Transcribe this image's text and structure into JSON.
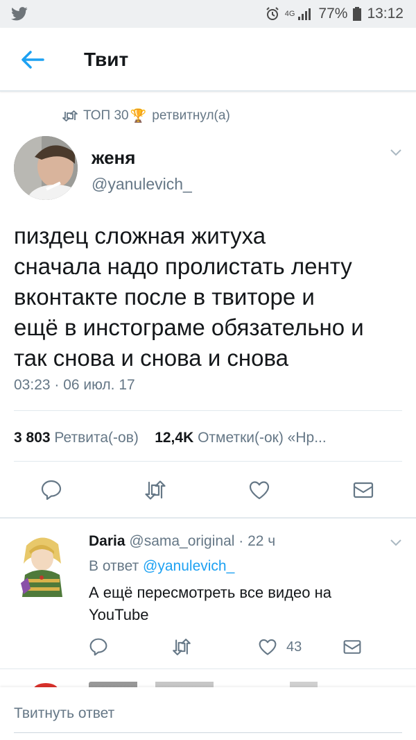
{
  "status_bar": {
    "app_icon": "twitter-bird-icon",
    "network": "4G",
    "battery": "77%",
    "time": "13:12"
  },
  "header": {
    "back_icon": "arrow-left-icon",
    "title": "Твит"
  },
  "retweet_context": {
    "icon": "retweet-icon",
    "user": "ТОП 30",
    "user_emoji": "🏆",
    "text": "ретвитнул(а)"
  },
  "tweet": {
    "author_name": "женя",
    "author_handle": "@yanulevich_",
    "text": "пиздец сложная житуха\nсначала надо пролистать ленту\nвконтакте после в твиторе и\nещё в инстограме обязательно и\nтак снова и снова и снова",
    "timestamp": "03:23 · 06 июл. 17",
    "retweet_count": "3 803",
    "retweet_label": "Ретвита(-ов)",
    "like_count": "12,4K",
    "like_label": "Отметки(-ок) «Нр...",
    "actions": [
      "reply-icon",
      "retweet-icon",
      "heart-icon",
      "mail-icon"
    ]
  },
  "reply": {
    "author_name": "Daria",
    "author_handle": "@sama_original",
    "time_ago": "· 22 ч",
    "reply_to_prefix": "В ответ",
    "reply_to_handle": "@yanulevich_",
    "text": "А ещё пересмотреть все видео на YouTube",
    "like_count": "43"
  },
  "compose": {
    "placeholder": "Твитнуть ответ"
  },
  "colors": {
    "accent": "#1da1f2",
    "text_primary": "#14171a",
    "text_secondary": "#657786",
    "divider": "#e1e8ed",
    "status_bar_bg": "#eef0f2"
  }
}
